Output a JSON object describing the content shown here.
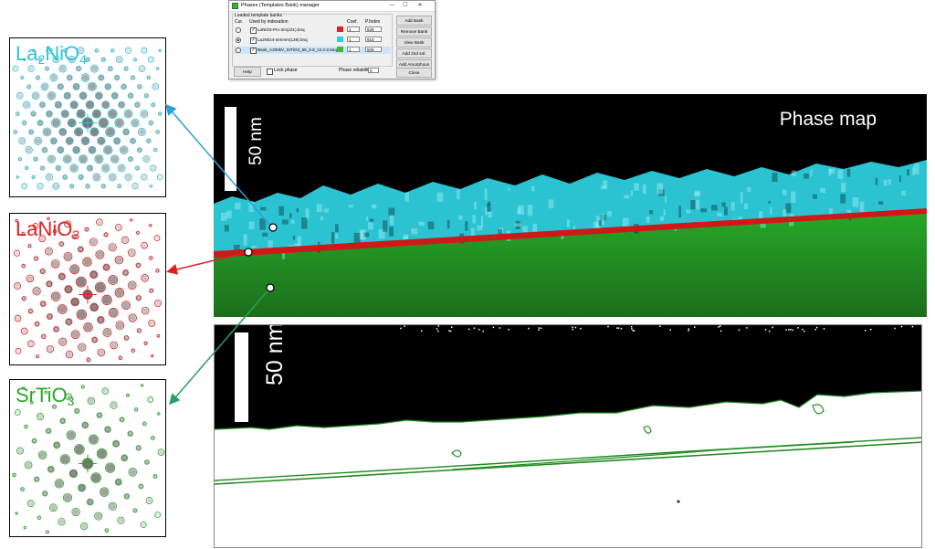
{
  "dialog": {
    "title": "Phases (Templates Bank) manager",
    "window_controls": {
      "minimize": "—",
      "maximize": "☐",
      "close": "✕"
    },
    "group_label": "Loaded template banks",
    "columns": {
      "cur": "Cur.",
      "used": "Used by indexation",
      "coef": "Coef.",
      "pindex": "P.Index"
    },
    "rows": [
      {
        "radio": false,
        "checked": true,
        "file": "LaNiO3-Pm-3m(221).bnq",
        "color": "#e02020",
        "coef": "1",
        "pindex": "629",
        "selected": false
      },
      {
        "radio": true,
        "checked": true,
        "file": "La2NiO4-I4mmm(139).bnq",
        "color": "#30d0e0",
        "coef": "1",
        "pindex": "915",
        "selected": false
      },
      {
        "radio": false,
        "checked": true,
        "file": "Bank_A200kV_SrTiO3_55_0.8_c2.2-2.bnq",
        "color": "#30c030",
        "coef": "1",
        "pindex": "506",
        "selected": true
      }
    ],
    "buttons": [
      "Add Bank",
      "Remove Bank",
      "View Bank",
      "Add 2nd sol.",
      "Add Amorphous",
      "Close"
    ],
    "help_label": "Help",
    "lock_label": "Lock phase",
    "reliability_label": "Phase reliability",
    "reliability_value": "0"
  },
  "panels": [
    {
      "name": "La2NiO4",
      "main": "La",
      "sub1": "2",
      "mid": "NiO",
      "sub2": "4",
      "color": "#2bc4d6"
    },
    {
      "name": "LaNiO3",
      "main": "LaNiO",
      "sub1": "3",
      "color": "#e02020"
    },
    {
      "name": "SrTiO3",
      "main": "SrTiO",
      "sub1": "3",
      "color": "#2aa82a"
    }
  ],
  "phase_map": {
    "label": "Phase map",
    "scale_label": "50 nm",
    "colors": {
      "la2nio4": "#2fd4e4",
      "lanio3": "#d01818",
      "srtio3": "#1fa01f",
      "background": "#000000"
    }
  },
  "boundary_map": {
    "scale_label": "50 nm",
    "colors": {
      "boundary": "#228b22",
      "background": "#000000"
    }
  },
  "arrows": {
    "blue": "#2a9fd6",
    "red": "#e02020",
    "green": "#2aa060"
  }
}
